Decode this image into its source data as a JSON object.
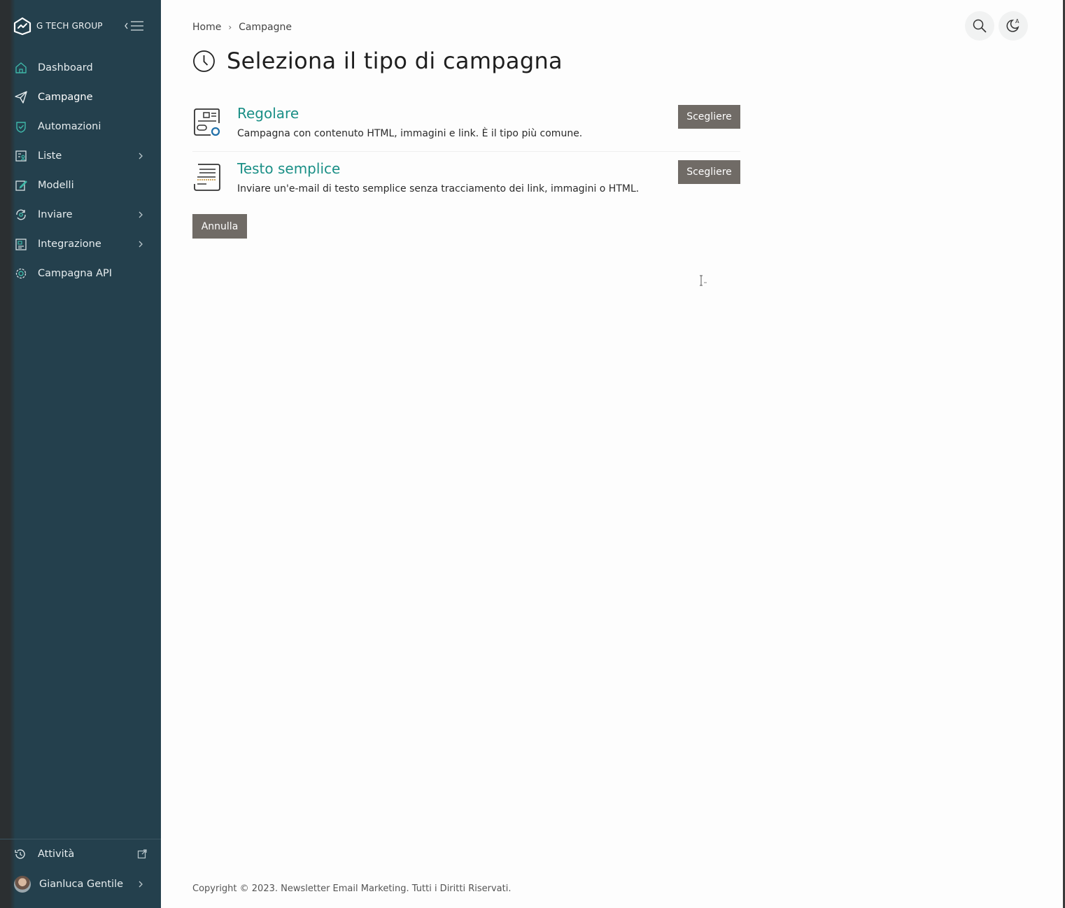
{
  "brand": {
    "name": "G TECH GROUP"
  },
  "sidebar": {
    "items": [
      {
        "label": "Dashboard",
        "icon": "home-icon",
        "has_chevron": false
      },
      {
        "label": "Campagne",
        "icon": "send-icon",
        "has_chevron": false,
        "active": true
      },
      {
        "label": "Automazioni",
        "icon": "shield-check-icon",
        "has_chevron": false
      },
      {
        "label": "Liste",
        "icon": "list-user-icon",
        "has_chevron": true
      },
      {
        "label": "Modelli",
        "icon": "edit-icon",
        "has_chevron": false
      },
      {
        "label": "Inviare",
        "icon": "refresh-icon",
        "has_chevron": true
      },
      {
        "label": "Integrazione",
        "icon": "integration-icon",
        "has_chevron": true
      },
      {
        "label": "Campagna API",
        "icon": "gear-icon",
        "has_chevron": false
      }
    ],
    "activity_label": "Attività",
    "user_name": "Gianluca Gentile"
  },
  "breadcrumb": {
    "home": "Home",
    "current": "Campagne",
    "separator": "›"
  },
  "page": {
    "title": "Seleziona il tipo di campagna"
  },
  "options": [
    {
      "title": "Regolare",
      "description": "Campagna con contenuto HTML, immagini e link. È il tipo più comune.",
      "button": "Scegliere"
    },
    {
      "title": "Testo semplice",
      "description": "Inviare un'e-mail di testo semplice senza tracciamento dei link, immagini o HTML.",
      "button": "Scegliere"
    }
  ],
  "cancel_label": "Annulla",
  "footer": {
    "text": "Copyright © 2023. Newsletter Email Marketing. Tutti i Diritti Riservati."
  },
  "colors": {
    "sidebar_bg": "#24404d",
    "accent_teal": "#1a8f86",
    "button_bg": "#706b66",
    "page_bg": "#fdfdfd"
  }
}
